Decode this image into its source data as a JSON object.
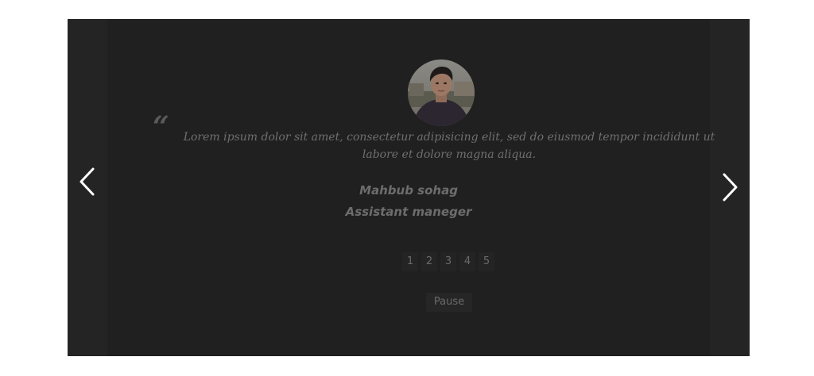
{
  "colors": {
    "page_background": "#ffffff",
    "slider_background": "#242424",
    "slide_background": "#202020",
    "text_muted": "#6f6f6f",
    "arrow": "#ffffff"
  },
  "icons": {
    "prev": "chevron-left-icon",
    "next": "chevron-right-icon",
    "quote": "quote-icon"
  },
  "testimonial": {
    "quote_mark": "“",
    "text": "Lorem ipsum dolor sit amet, consectetur adipisicing elit, sed do eiusmod tempor incididunt ut labore et dolore magna aliqua.",
    "author_name": "Mahbub sohag",
    "author_role": "Assistant maneger"
  },
  "pager": {
    "pages": [
      "1",
      "2",
      "3",
      "4",
      "5"
    ]
  },
  "controls": {
    "pause_label": "Pause"
  }
}
